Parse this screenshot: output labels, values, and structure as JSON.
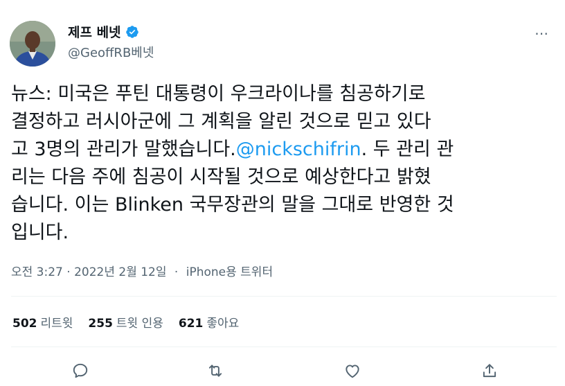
{
  "author": {
    "display_name": "제프 베넷",
    "handle": "@GeoffRB베넷",
    "verified_icon": "verified-badge-icon",
    "badge_color": "#1d9bf0"
  },
  "tweet": {
    "text_before_mention": "뉴스: 미국은 푸틴 대통령이 우크라이나를 침공하기로\n결정하고 러시아군에 그 계획을 알린 것으로 믿고 있다\n고 3명의 관리가 말했습니다.",
    "mention": "@nickschifrin",
    "text_after_mention": ". 두 관리 관\n리는 다음 주에 침공이 시작될 것으로 예상한다고 밝혔\n습니다. 이는 Blinken 국무장관의 말을 그대로 반영한 것\n입니다."
  },
  "meta": {
    "timestamp": "오전 3:27 · 2022년 2월 12일",
    "separator": "·",
    "source": "iPhone용 트위터"
  },
  "stats": {
    "retweets_count": "502",
    "retweets_label": "리트윗",
    "quotes_count": "255",
    "quotes_label": "트윗 인용",
    "likes_count": "621",
    "likes_label": "좋아요"
  },
  "actions": {
    "reply": "reply-icon",
    "retweet": "retweet-icon",
    "like": "like-icon",
    "share": "share-icon"
  },
  "more_menu": "⋯",
  "colors": {
    "text": "#0f1419",
    "secondary": "#536471",
    "link": "#1d9bf0",
    "divider": "#eff3f4"
  }
}
